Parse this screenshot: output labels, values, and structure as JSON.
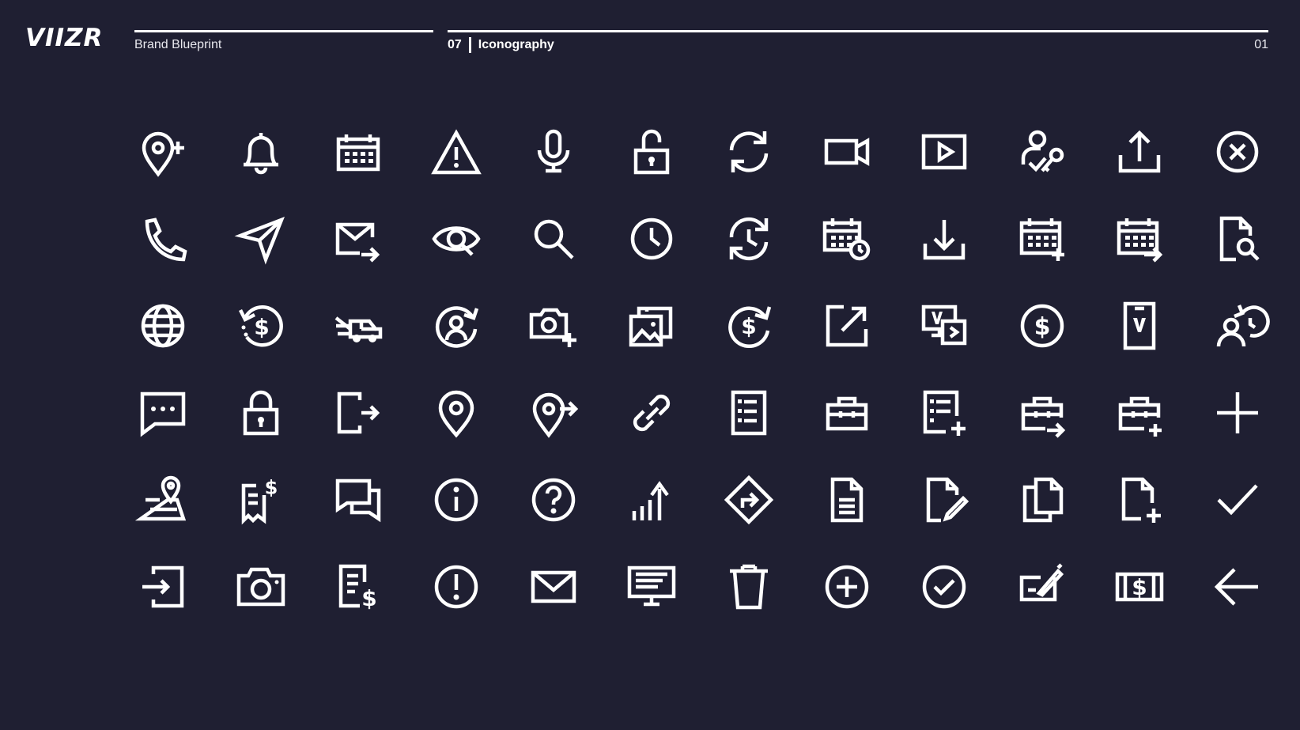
{
  "header": {
    "logo": "VIIZR",
    "brand_label": "Brand Blueprint",
    "section_number": "07",
    "section_title": "Iconography",
    "page_number": "01"
  },
  "colors": {
    "background": "#1f1f32",
    "foreground": "#ffffff"
  },
  "icons": [
    [
      "location-add-icon",
      "bell-icon",
      "calendar-icon",
      "warning-icon",
      "microphone-icon",
      "unlock-icon",
      "refresh-icon",
      "video-camera-icon",
      "play-video-icon",
      "user-key-icon",
      "upload-icon",
      "close-circle-icon"
    ],
    [
      "phone-icon",
      "send-icon",
      "mail-forward-icon",
      "view-icon",
      "search-icon",
      "clock-icon",
      "history-icon",
      "calendar-clock-icon",
      "download-icon",
      "calendar-add-icon",
      "calendar-forward-icon",
      "document-search-icon"
    ],
    [
      "globe-icon",
      "refund-icon",
      "towing-truck-icon",
      "user-sync-icon",
      "camera-add-icon",
      "gallery-icon",
      "recurring-payment-icon",
      "external-link-icon",
      "screen-share-icon",
      "dollar-circle-icon",
      "mobile-app-icon",
      "user-history-icon"
    ],
    [
      "chat-icon",
      "lock-icon",
      "logout-icon",
      "location-pin-icon",
      "location-share-icon",
      "link-icon",
      "list-document-icon",
      "toolbox-icon",
      "list-add-icon",
      "toolbox-forward-icon",
      "toolbox-add-icon",
      "plus-icon"
    ],
    [
      "map-icon",
      "invoice-dollar-icon",
      "messages-icon",
      "info-icon",
      "help-icon",
      "stats-up-icon",
      "directions-icon",
      "document-icon",
      "document-edit-icon",
      "copy-icon",
      "document-add-icon",
      "check-icon"
    ],
    [
      "login-icon",
      "camera-icon",
      "billing-icon",
      "alert-circle-icon",
      "envelope-icon",
      "presentation-icon",
      "trash-icon",
      "plus-circle-icon",
      "check-circle-icon",
      "signature-icon",
      "cash-icon",
      "arrow-left-icon"
    ]
  ]
}
